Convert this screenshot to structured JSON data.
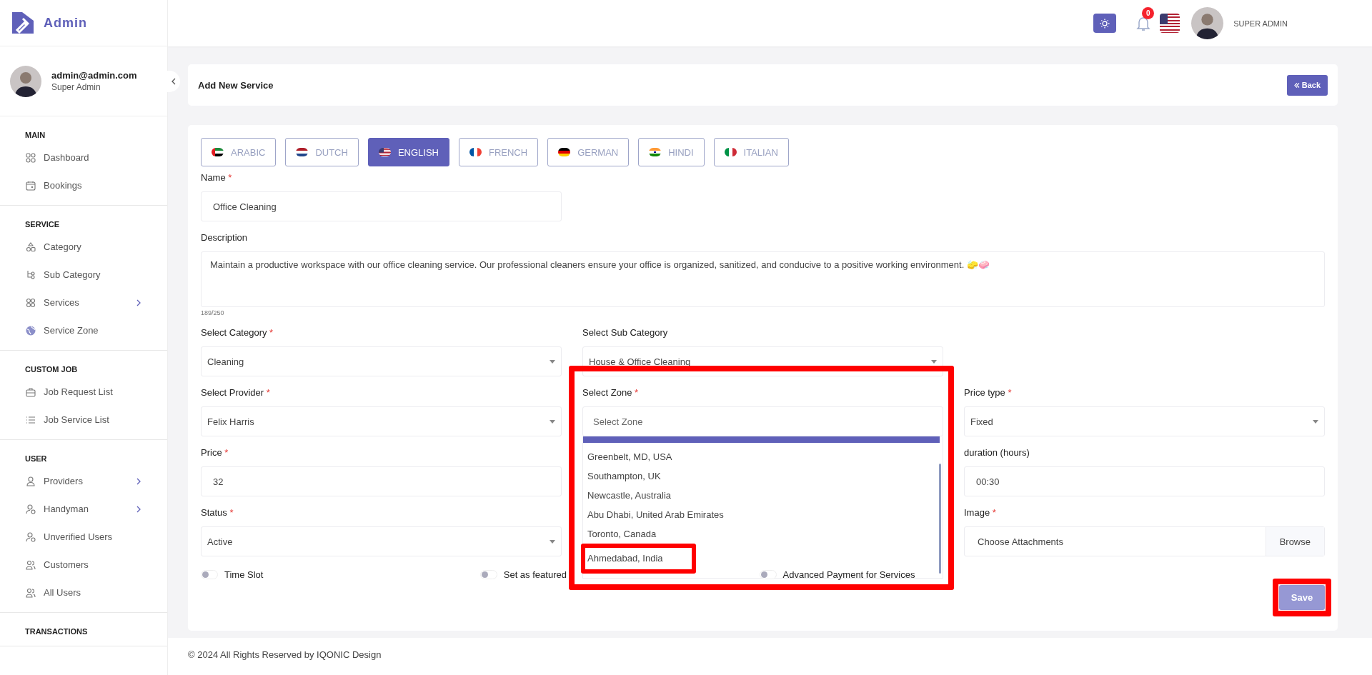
{
  "brand": {
    "name": "Admin"
  },
  "profile": {
    "email": "admin@admin.com",
    "role": "Super Admin"
  },
  "sidebar": {
    "sections": [
      {
        "title": "MAIN",
        "items": [
          {
            "label": "Dashboard",
            "submenu": false
          },
          {
            "label": "Bookings",
            "submenu": false
          }
        ]
      },
      {
        "title": "SERVICE",
        "items": [
          {
            "label": "Category",
            "submenu": false
          },
          {
            "label": "Sub Category",
            "submenu": false
          },
          {
            "label": "Services",
            "submenu": true
          },
          {
            "label": "Service Zone",
            "submenu": false
          }
        ]
      },
      {
        "title": "CUSTOM JOB",
        "items": [
          {
            "label": "Job Request List",
            "submenu": false
          },
          {
            "label": "Job Service List",
            "submenu": false
          }
        ]
      },
      {
        "title": "USER",
        "items": [
          {
            "label": "Providers",
            "submenu": true
          },
          {
            "label": "Handyman",
            "submenu": true
          },
          {
            "label": "Unverified Users",
            "submenu": false
          },
          {
            "label": "Customers",
            "submenu": false
          },
          {
            "label": "All Users",
            "submenu": false
          }
        ]
      },
      {
        "title": "TRANSACTIONS"
      }
    ]
  },
  "header": {
    "notifications": "0",
    "user": "SUPER ADMIN"
  },
  "page": {
    "title": "Add New Service",
    "back": "Back"
  },
  "languages": [
    {
      "label": "ARABIC",
      "selected": false
    },
    {
      "label": "DUTCH",
      "selected": false
    },
    {
      "label": "ENGLISH",
      "selected": true
    },
    {
      "label": "FRENCH",
      "selected": false
    },
    {
      "label": "GERMAN",
      "selected": false
    },
    {
      "label": "HINDI",
      "selected": false
    },
    {
      "label": "ITALIAN",
      "selected": false
    }
  ],
  "fields": [
    {
      "kind": "input",
      "label": "Name",
      "required_mark": "*",
      "value": "Office Cleaning"
    },
    {
      "kind": "textarea",
      "label": "Description",
      "value": "Maintain a productive workspace with our office cleaning service. Our professional cleaners ensure your office is organized, sanitized, and conducive to a positive working environment. 🧽🧼",
      "counter": "189/250"
    },
    {
      "kind": "select",
      "label": "Select Category",
      "required_mark": "*",
      "value": "Cleaning"
    },
    {
      "kind": "select",
      "label": "Select Sub Category",
      "value": "House & Office Cleaning"
    },
    {
      "kind": "select",
      "label": "Select Provider",
      "required_mark": "*",
      "value": "Felix Harris"
    },
    {
      "kind": "zone",
      "label": "Select Zone",
      "required_mark": "*",
      "placeholder": "Select Zone",
      "expanded": true,
      "highlighted": true,
      "options": [
        {
          "label": "Greenbelt, MD, USA",
          "highlighted": false
        },
        {
          "label": "Southampton, UK",
          "highlighted": false
        },
        {
          "label": "Newcastle, Australia",
          "highlighted": false
        },
        {
          "label": "Abu Dhabi, United Arab Emirates",
          "highlighted": false
        },
        {
          "label": "Toronto, Canada",
          "highlighted": false
        },
        {
          "label": "Ahmedabad, India",
          "highlighted": true
        }
      ]
    },
    {
      "kind": "select",
      "label": "Price type",
      "required_mark": "*",
      "value": "Fixed"
    },
    {
      "kind": "input",
      "label": "Price",
      "required_mark": "*",
      "value": "32"
    },
    {
      "kind": "input",
      "label": "duration (hours)",
      "value": "00:30"
    },
    {
      "kind": "select",
      "label": "Status",
      "required_mark": "*",
      "value": "Active"
    },
    {
      "kind": "file",
      "label": "Image",
      "required_mark": "*",
      "placeholder": "Choose Attachments",
      "button": "Browse"
    }
  ],
  "toggles": [
    {
      "label": "Time Slot",
      "on": false
    },
    {
      "label": "Set as featured",
      "on": false
    },
    {
      "label": "Advanced Payment for Services",
      "on": false
    }
  ],
  "save": {
    "label": "Save",
    "highlighted": true
  },
  "footer": "© 2024 All Rights Reserved by IQONIC Design"
}
